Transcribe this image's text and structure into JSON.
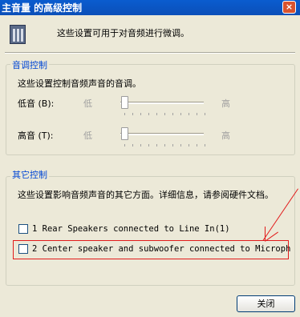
{
  "window": {
    "title": "主音量 的高级控制",
    "close_glyph": "×"
  },
  "header": {
    "description": "这些设置可用于对音频进行微调。",
    "icon": "mixer-icon"
  },
  "tone_group": {
    "legend": "音调控制",
    "description": "这些设置控制音频声音的音调。",
    "bass": {
      "label": "低音 (B):",
      "low_label": "低",
      "high_label": "高",
      "level": 0.0
    },
    "treble": {
      "label": "高音 (T):",
      "low_label": "低",
      "high_label": "高",
      "level": 0.0
    }
  },
  "other_group": {
    "legend": "其它控制",
    "description": "这些设置影响音频声音的其它方面。详细信息，请参阅硬件文档。",
    "options": [
      {
        "label": "1  Rear Speakers connected to Line In(1)",
        "checked": false
      },
      {
        "label": "2  Center speaker and subwoofer connected to Microph",
        "checked": false
      }
    ]
  },
  "footer": {
    "close_button": "关闭"
  },
  "annotation_color": "#e21b1b"
}
